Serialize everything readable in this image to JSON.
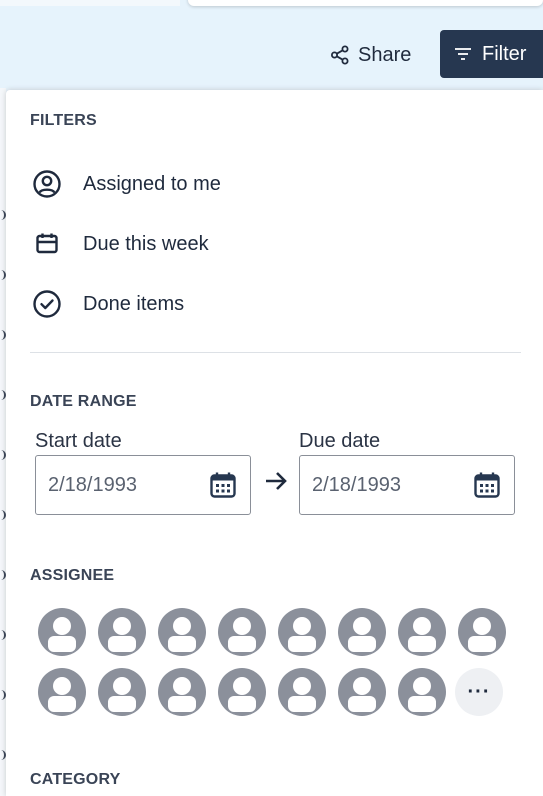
{
  "toolbar": {
    "share_label": "Share",
    "filter_label": "Filter"
  },
  "filters": {
    "title": "FILTERS",
    "items": [
      {
        "label": "Assigned to me",
        "icon": "user-circle-icon"
      },
      {
        "label": "Due this week",
        "icon": "calendar-icon"
      },
      {
        "label": "Done items",
        "icon": "check-circle-icon"
      }
    ]
  },
  "date_range": {
    "title": "DATE RANGE",
    "start_label": "Start date",
    "start_value": "2/18/1993",
    "due_label": "Due date",
    "due_value": "2/18/1993"
  },
  "assignee": {
    "title": "ASSIGNEE",
    "avatar_count": 15,
    "more_label": "···"
  },
  "category": {
    "title": "CATEGORY"
  },
  "colors": {
    "accent": "#263750",
    "avatar": "#8b909b",
    "background": "#e8f3fb"
  }
}
